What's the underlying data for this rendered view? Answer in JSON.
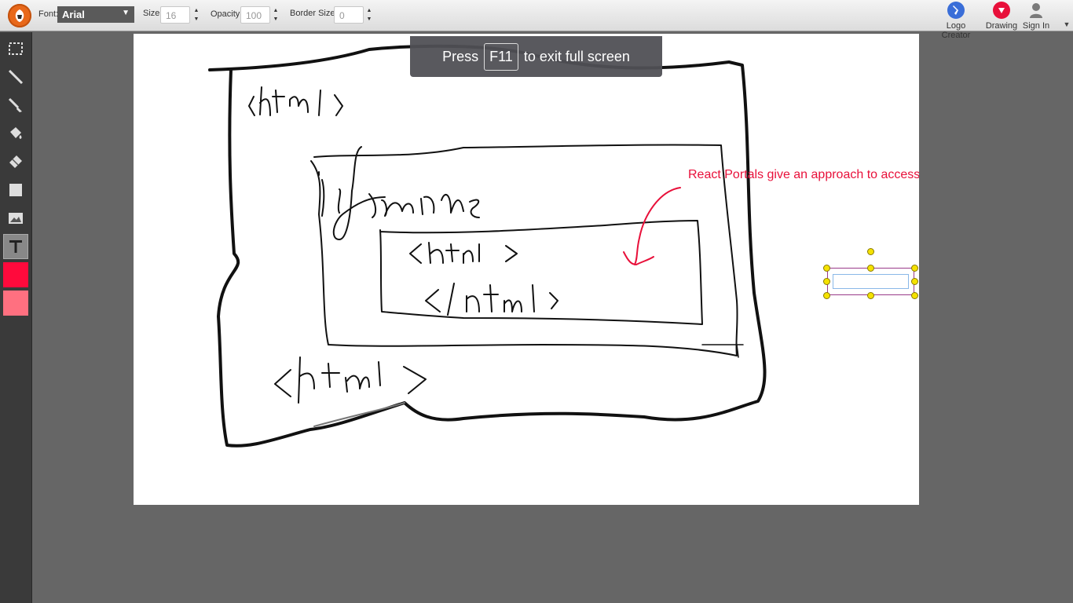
{
  "toolbar": {
    "font_label": "Font:",
    "font_value": "Arial",
    "size_label": "Size:",
    "size_value": "16",
    "opacity_label": "Opacity:",
    "opacity_value": "100",
    "border_label": "Border Size:",
    "border_value": "0",
    "right_items": [
      {
        "label": "Logo Creator",
        "icon": "logo-creator-icon"
      },
      {
        "label": "Drawing",
        "icon": "drawing-icon"
      },
      {
        "label": "Sign In",
        "icon": "user-icon"
      }
    ]
  },
  "tools": [
    {
      "name": "select-tool",
      "icon": "marquee-icon"
    },
    {
      "name": "pencil-tool",
      "icon": "pencil-icon"
    },
    {
      "name": "brush-tool",
      "icon": "brush-icon"
    },
    {
      "name": "fill-tool",
      "icon": "paint-bucket-icon"
    },
    {
      "name": "eraser-tool",
      "icon": "eraser-icon"
    },
    {
      "name": "shape-tool",
      "icon": "rectangle-icon"
    },
    {
      "name": "image-tool",
      "icon": "image-icon"
    },
    {
      "name": "text-tool",
      "icon": "text-icon",
      "active": true
    }
  ],
  "colors": {
    "primary": "#ff0a3c",
    "secondary": "#ff7080",
    "annotation": "#e8103a"
  },
  "fullscreen_notice": {
    "before": "Press",
    "key": "F11",
    "after": "to exit full screen"
  },
  "canvas": {
    "annotation_text": "React Portals give an  approach to access"
  }
}
